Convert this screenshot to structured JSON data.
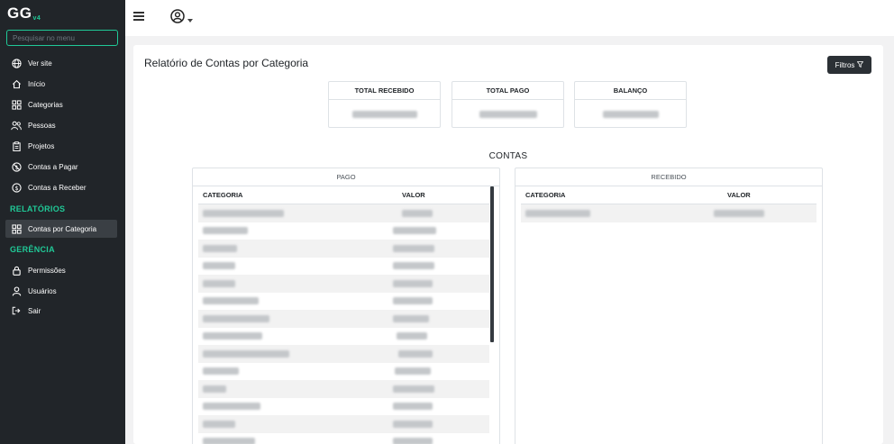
{
  "app": {
    "logo": "GG",
    "logo_version": "v4"
  },
  "sidebar": {
    "search_placeholder": "Pesquisar no menu",
    "items": [
      {
        "label": "Ver site",
        "icon": "globe-icon"
      },
      {
        "label": "Início",
        "icon": "home-icon"
      },
      {
        "label": "Categorias",
        "icon": "grid-icon"
      },
      {
        "label": "Pessoas",
        "icon": "users-icon"
      },
      {
        "label": "Projetos",
        "icon": "clipboard-icon"
      },
      {
        "label": "Contas a Pagar",
        "icon": "no-money-icon"
      },
      {
        "label": "Contas a Receber",
        "icon": "dollar-icon"
      }
    ],
    "section_reports": "RELATÓRIOS",
    "report_items": [
      {
        "label": "Contas por Categoria",
        "icon": "grid-icon"
      }
    ],
    "section_management": "GERÊNCIA",
    "management_items": [
      {
        "label": "Permissões",
        "icon": "lock-icon"
      },
      {
        "label": "Usuários",
        "icon": "user-icon"
      },
      {
        "label": "Sair",
        "icon": "logout-icon"
      }
    ]
  },
  "header": {
    "user_icon": "user-circle-icon"
  },
  "main": {
    "title": "Relatório de Contas por Categoria",
    "filter_label": "Filtros",
    "stats": [
      {
        "label": "TOTAL RECEBIDO"
      },
      {
        "label": "TOTAL PAGO"
      },
      {
        "label": "BALANÇO"
      }
    ],
    "section_title": "CONTAS",
    "paid_panel": {
      "title": "PAGO",
      "col_category": "CATEGORIA",
      "col_value": "VALOR"
    },
    "received_panel": {
      "title": "RECEBIDO",
      "col_category": "CATEGORIA",
      "col_value": "VALOR"
    }
  },
  "colors": {
    "accent": "#20c997",
    "sidebar_bg": "#212529",
    "button_dark": "#2b3035"
  }
}
